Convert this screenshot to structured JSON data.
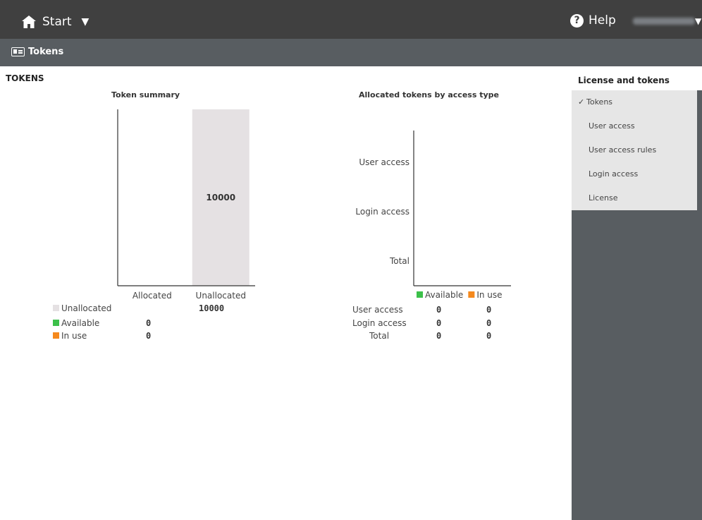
{
  "header": {
    "start_label": "Start",
    "help_label": "Help"
  },
  "subheader": {
    "breadcrumb": "Tokens"
  },
  "page": {
    "heading": "TOKENS"
  },
  "sidebar": {
    "title": "License and tokens",
    "items": [
      {
        "label": "Tokens",
        "active": true
      },
      {
        "label": "User access",
        "active": false
      },
      {
        "label": "User access rules",
        "active": false
      },
      {
        "label": "Login access",
        "active": false
      },
      {
        "label": "License",
        "active": false
      }
    ]
  },
  "colors": {
    "unallocated": "#e5e1e3",
    "available": "#3cc04a",
    "in_use": "#f5891d"
  },
  "chart_data": [
    {
      "type": "bar",
      "title": "Token summary",
      "categories": [
        "Allocated",
        "Unallocated"
      ],
      "series": [
        {
          "name": "Unallocated",
          "values": [
            0,
            10000
          ]
        },
        {
          "name": "Available",
          "values": [
            0,
            0
          ]
        },
        {
          "name": "In use",
          "values": [
            0,
            0
          ]
        }
      ],
      "data_labels": [
        "",
        "10000"
      ],
      "legend_table": [
        {
          "label": "Unallocated",
          "allocated": "",
          "unallocated": "10000"
        },
        {
          "label": "Available",
          "allocated": "0",
          "unallocated": ""
        },
        {
          "label": "In use",
          "allocated": "0",
          "unallocated": ""
        }
      ],
      "ylim": [
        0,
        10000
      ]
    },
    {
      "type": "bar",
      "orientation": "horizontal",
      "title": "Allocated tokens by access type",
      "categories": [
        "User access",
        "Login access",
        "Total"
      ],
      "series": [
        {
          "name": "Available",
          "values": [
            0,
            0,
            0
          ]
        },
        {
          "name": "In use",
          "values": [
            0,
            0,
            0
          ]
        }
      ],
      "legend_table": [
        {
          "label": "User access",
          "available": "0",
          "in_use": "0"
        },
        {
          "label": "Login access",
          "available": "0",
          "in_use": "0"
        },
        {
          "label": "Total",
          "available": "0",
          "in_use": "0"
        }
      ]
    }
  ]
}
